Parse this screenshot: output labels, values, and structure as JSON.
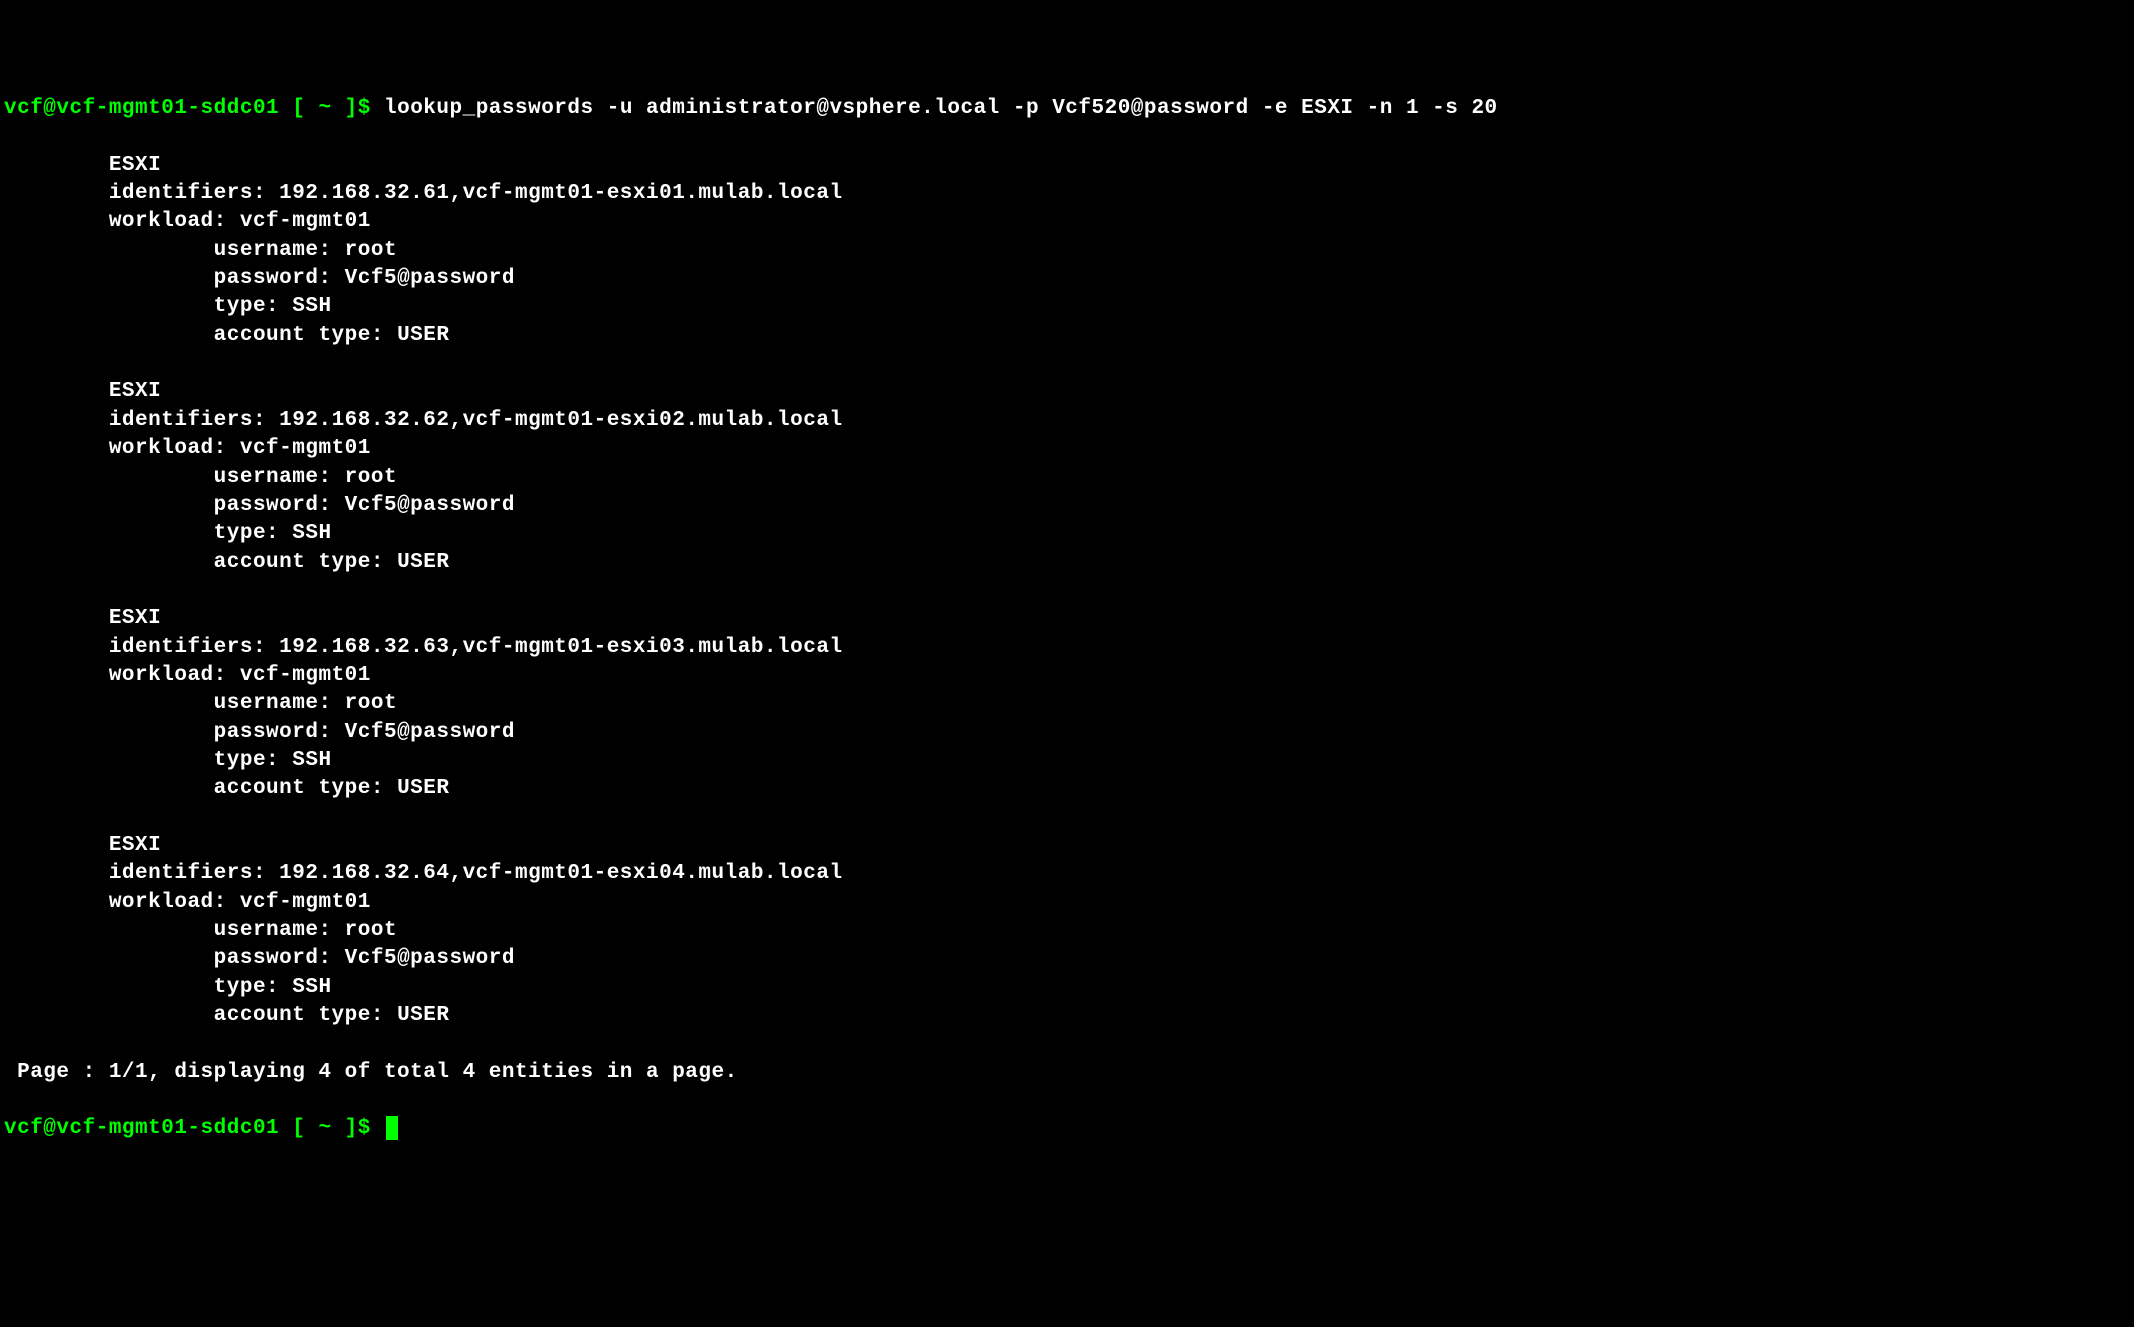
{
  "prompt": {
    "user_host": "vcf@vcf-mgmt01-sddc01",
    "path_prefix": " [ ~ ]$ "
  },
  "command": "lookup_passwords -u administrator@vsphere.local -p Vcf520@password -e ESXI -n 1 -s 20",
  "entries": [
    {
      "header": "ESXI",
      "identifiers": "identifiers: 192.168.32.61,vcf-mgmt01-esxi01.mulab.local",
      "workload": "workload: vcf-mgmt01",
      "username": "username: root",
      "password": "password: Vcf5@password",
      "type": "type: SSH",
      "account_type": "account type: USER"
    },
    {
      "header": "ESXI",
      "identifiers": "identifiers: 192.168.32.62,vcf-mgmt01-esxi02.mulab.local",
      "workload": "workload: vcf-mgmt01",
      "username": "username: root",
      "password": "password: Vcf5@password",
      "type": "type: SSH",
      "account_type": "account type: USER"
    },
    {
      "header": "ESXI",
      "identifiers": "identifiers: 192.168.32.63,vcf-mgmt01-esxi03.mulab.local",
      "workload": "workload: vcf-mgmt01",
      "username": "username: root",
      "password": "password: Vcf5@password",
      "type": "type: SSH",
      "account_type": "account type: USER"
    },
    {
      "header": "ESXI",
      "identifiers": "identifiers: 192.168.32.64,vcf-mgmt01-esxi04.mulab.local",
      "workload": "workload: vcf-mgmt01",
      "username": "username: root",
      "password": "password: Vcf5@password",
      "type": "type: SSH",
      "account_type": "account type: USER"
    }
  ],
  "pagination": " Page : 1/1, displaying 4 of total 4 entities in a page."
}
